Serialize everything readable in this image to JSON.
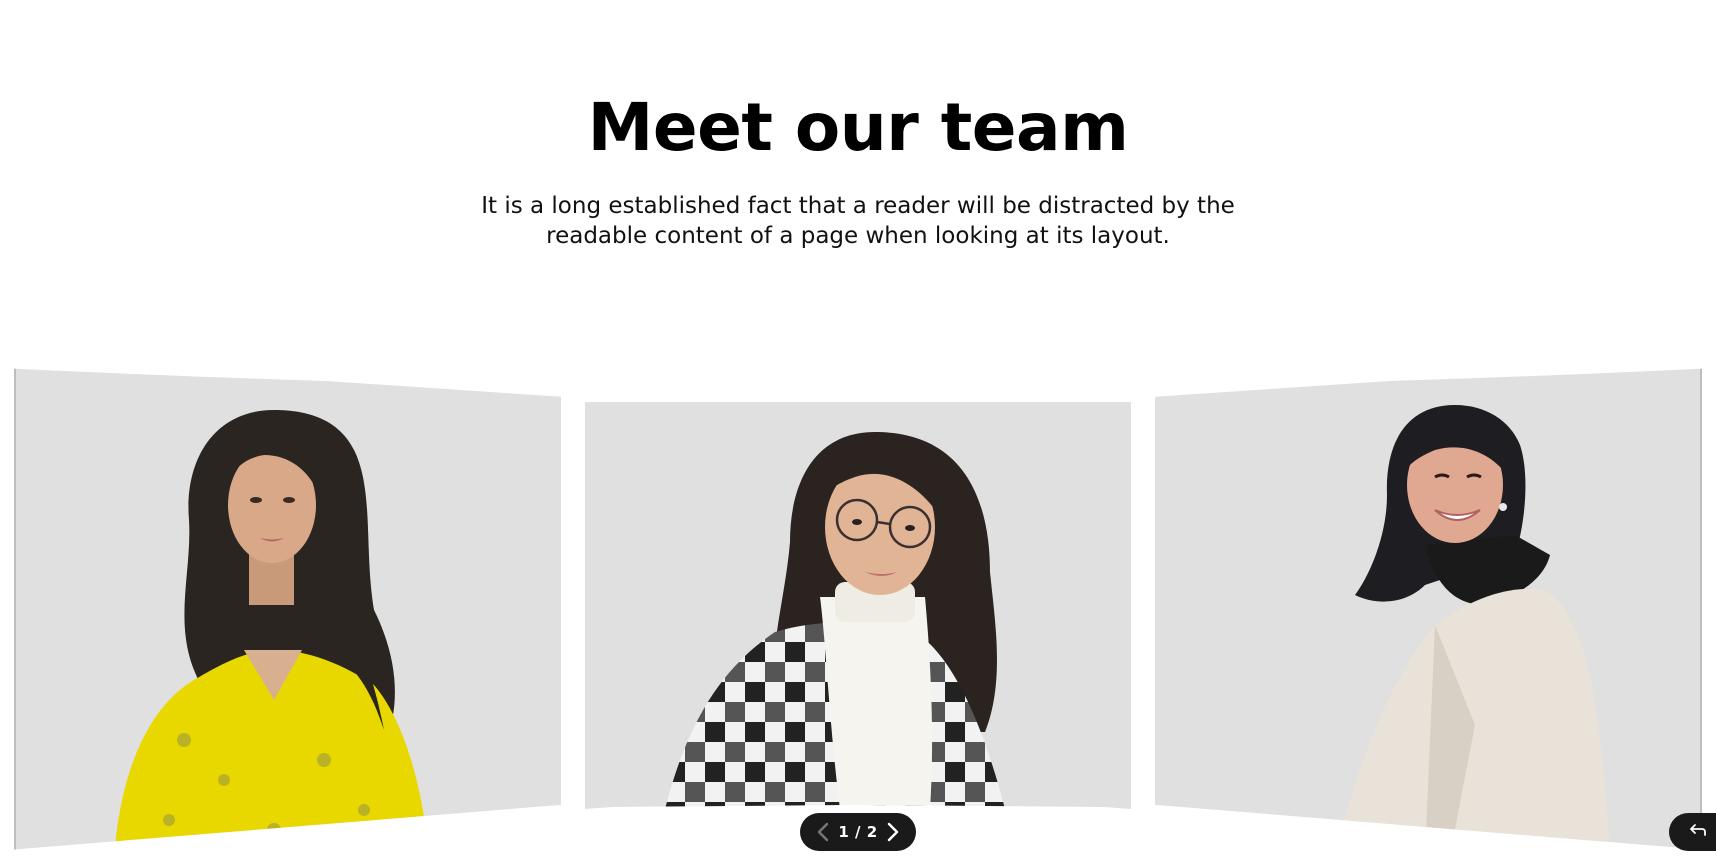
{
  "hero": {
    "title": "Meet our team",
    "subtitle": "It is a long established fact that a reader will be distracted by the readable content of a page when looking at its layout."
  },
  "carousel": {
    "pager": {
      "current": "1",
      "separator": "/",
      "total": "2",
      "label": "1 / 2"
    },
    "cards": [
      {
        "position": "left",
        "shirt_color": "#e8d800",
        "bg": "#e0e0e0"
      },
      {
        "position": "center",
        "shirt_color": "#ffffff",
        "bg": "#e0e0e0"
      },
      {
        "position": "right",
        "shirt_color": "#e8e2d8",
        "bg": "#e0e0e0"
      }
    ],
    "icons": {
      "prev": "chevron-left-icon",
      "next": "chevron-right-icon",
      "back": "undo-arrow-icon"
    }
  },
  "colors": {
    "pager_bg": "#1a1a1a",
    "card_bg": "#e0e0e0",
    "page_bg": "#ffffff"
  }
}
